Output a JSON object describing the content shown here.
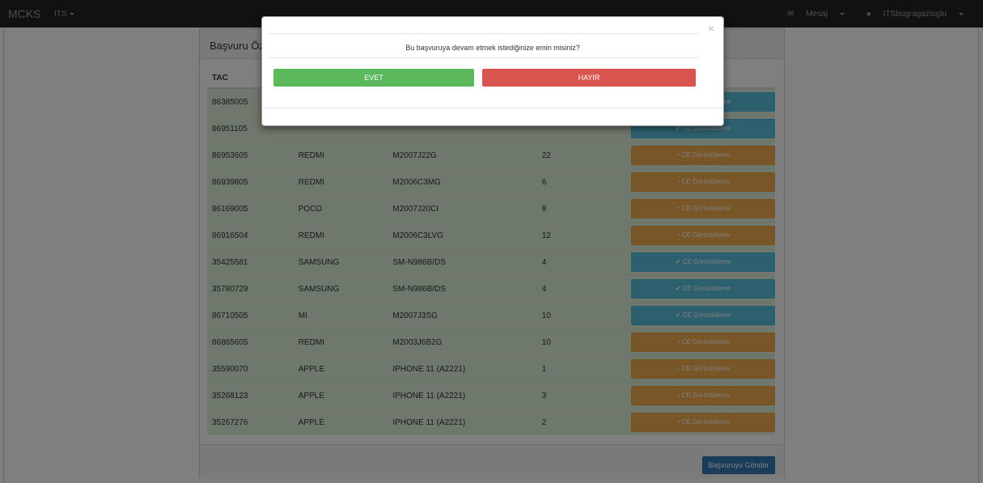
{
  "navbar": {
    "brand": "MCKS",
    "its_menu": "ITS",
    "message_menu": "Mesaj",
    "user_menu": "ITSbugragazioglu"
  },
  "panel": {
    "title": "Başvuru Öze",
    "submit_label": "Başvuruyu Gönder"
  },
  "table": {
    "header_tac": "TAC",
    "rows": [
      {
        "tac": "86385005",
        "brand": "",
        "model": "",
        "qty": "",
        "status": "CE Görüntüleme",
        "color": "#5bc0de"
      },
      {
        "tac": "86951105",
        "brand": "",
        "model": "",
        "qty": "",
        "status": "CE Görüntüleme",
        "color": "#5bc0de"
      },
      {
        "tac": "86953605",
        "brand": "REDMI",
        "model": "M2007J22G",
        "qty": "22",
        "status": "CE Görüntüleme",
        "color": "#f0ad4e"
      },
      {
        "tac": "86939805",
        "brand": "REDMI",
        "model": "M2006C3MG",
        "qty": "6",
        "status": "CE Görüntüleme",
        "color": "#f0ad4e"
      },
      {
        "tac": "86169005",
        "brand": "POCO",
        "model": "M2007J20CI",
        "qty": "8",
        "status": "CE Görüntüleme",
        "color": "#f0ad4e"
      },
      {
        "tac": "86916504",
        "brand": "REDMI",
        "model": "M2006C3LVG",
        "qty": "12",
        "status": "CE Görüntüleme",
        "color": "#f0ad4e"
      },
      {
        "tac": "35425581",
        "brand": "SAMSUNG",
        "model": "SM-N986B/DS",
        "qty": "4",
        "status": "CE Görüntüleme",
        "color": "#5bc0de"
      },
      {
        "tac": "35780729",
        "brand": "SAMSUNG",
        "model": "SM-N986B/DS",
        "qty": "4",
        "status": "CE Görüntüleme",
        "color": "#5bc0de"
      },
      {
        "tac": "86710505",
        "brand": "MI",
        "model": "M2007J3SG",
        "qty": "10",
        "status": "CE Görüntüleme",
        "color": "#5bc0de"
      },
      {
        "tac": "86865605",
        "brand": "REDMI",
        "model": "M2003J6B2G",
        "qty": "10",
        "status": "CE Görüntüleme",
        "color": "#f0ad4e"
      },
      {
        "tac": "35590070",
        "brand": "APPLE",
        "model": "IPHONE 11 (A2221)",
        "qty": "1",
        "status": "CE Görüntüleme",
        "color": "#f0ad4e"
      },
      {
        "tac": "35268123",
        "brand": "APPLE",
        "model": "IPHONE 11 (A2221)",
        "qty": "3",
        "status": "CE Görüntüleme",
        "color": "#f0ad4e"
      },
      {
        "tac": "35267276",
        "brand": "APPLE",
        "model": "IPHONE 11 (A2221)",
        "qty": "2",
        "status": "CE Görüntüleme",
        "color": "#f0ad4e"
      }
    ]
  },
  "modal": {
    "close_glyph": "×",
    "question": "Bu başvuruya devam etmek istediğinize emin misiniz?",
    "yes_label": "EVET",
    "no_label": "HAYIR"
  },
  "icons": {
    "check": "✔",
    "clock": "◔",
    "envelope": "✉",
    "user": "👤"
  }
}
